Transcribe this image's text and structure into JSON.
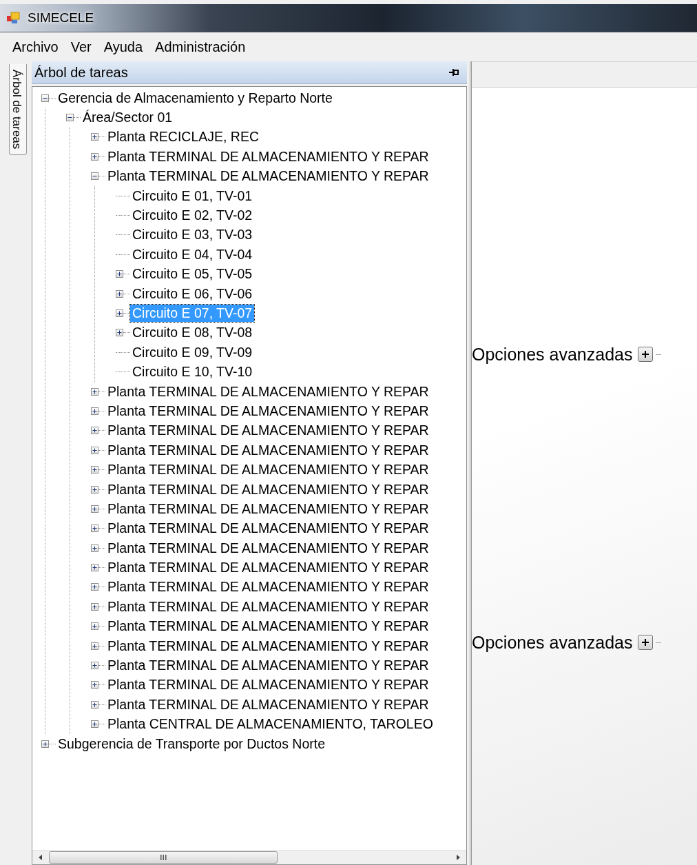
{
  "window": {
    "title": "SIMECELE"
  },
  "menu": [
    "Archivo",
    "Ver",
    "Ayuda",
    "Administración"
  ],
  "side_tab": {
    "label": "Árbol de tareas",
    "selected": true
  },
  "panel": {
    "title": "Árbol de tareas"
  },
  "tree": [
    {
      "label": "Gerencia de Almacenamiento y Reparto Norte",
      "expanded": true,
      "selected": false,
      "children": [
        {
          "label": "Área/Sector 01",
          "expanded": true,
          "selected": false,
          "children": [
            {
              "label": "Planta RECICLAJE, REC",
              "expanded": false,
              "selected": false
            },
            {
              "label": "Planta TERMINAL DE ALMACENAMIENTO Y REPAR",
              "expanded": false,
              "selected": false
            },
            {
              "label": "Planta TERMINAL DE ALMACENAMIENTO Y REPAR",
              "expanded": true,
              "selected": false,
              "children": [
                {
                  "label": "Circuito E 01, TV-01",
                  "selected": false
                },
                {
                  "label": "Circuito E 02, TV-02",
                  "selected": false
                },
                {
                  "label": "Circuito E 03, TV-03",
                  "selected": false
                },
                {
                  "label": "Circuito E 04, TV-04",
                  "selected": false
                },
                {
                  "label": "Circuito E 05, TV-05",
                  "expanded": false,
                  "selected": false
                },
                {
                  "label": "Circuito E 06, TV-06",
                  "expanded": false,
                  "selected": false
                },
                {
                  "label": "Circuito E 07, TV-07",
                  "expanded": false,
                  "selected": true
                },
                {
                  "label": "Circuito E 08, TV-08",
                  "expanded": false,
                  "selected": false
                },
                {
                  "label": "Circuito E 09, TV-09",
                  "selected": false
                },
                {
                  "label": "Circuito E 10, TV-10",
                  "selected": false
                }
              ]
            },
            {
              "label": "Planta TERMINAL DE ALMACENAMIENTO Y REPAR",
              "expanded": false,
              "selected": false
            },
            {
              "label": "Planta TERMINAL DE ALMACENAMIENTO Y REPAR",
              "expanded": false,
              "selected": false
            },
            {
              "label": "Planta TERMINAL DE ALMACENAMIENTO Y REPAR",
              "expanded": false,
              "selected": false
            },
            {
              "label": "Planta TERMINAL DE ALMACENAMIENTO Y REPAR",
              "expanded": false,
              "selected": false
            },
            {
              "label": "Planta TERMINAL DE ALMACENAMIENTO Y REPAR",
              "expanded": false,
              "selected": false
            },
            {
              "label": "Planta TERMINAL DE ALMACENAMIENTO Y REPAR",
              "expanded": false,
              "selected": false
            },
            {
              "label": "Planta TERMINAL DE ALMACENAMIENTO Y REPAR",
              "expanded": false,
              "selected": false
            },
            {
              "label": "Planta TERMINAL DE ALMACENAMIENTO Y REPAR",
              "expanded": false,
              "selected": false
            },
            {
              "label": "Planta TERMINAL DE ALMACENAMIENTO Y REPAR",
              "expanded": false,
              "selected": false
            },
            {
              "label": "Planta TERMINAL DE ALMACENAMIENTO Y REPAR",
              "expanded": false,
              "selected": false
            },
            {
              "label": "Planta TERMINAL DE ALMACENAMIENTO Y REPAR",
              "expanded": false,
              "selected": false
            },
            {
              "label": "Planta TERMINAL DE ALMACENAMIENTO Y REPAR",
              "expanded": false,
              "selected": false
            },
            {
              "label": "Planta TERMINAL DE ALMACENAMIENTO Y REPAR",
              "expanded": false,
              "selected": false
            },
            {
              "label": "Planta TERMINAL DE ALMACENAMIENTO Y REPAR",
              "expanded": false,
              "selected": false
            },
            {
              "label": "Planta TERMINAL DE ALMACENAMIENTO Y REPAR",
              "expanded": false,
              "selected": false
            },
            {
              "label": "Planta TERMINAL DE ALMACENAMIENTO Y REPAR",
              "expanded": false,
              "selected": false
            },
            {
              "label": "Planta TERMINAL DE ALMACENAMIENTO Y REPAR",
              "expanded": false,
              "selected": false
            },
            {
              "label": "Planta CENTRAL DE ALMACENAMIENTO, TAROLEO",
              "expanded": false,
              "selected": false
            }
          ]
        }
      ]
    },
    {
      "label": "Subgerencia de Transporte por Ductos Norte",
      "expanded": false,
      "selected": false
    }
  ],
  "advanced": [
    {
      "label": "Opciones avanzadas",
      "expanded": false
    },
    {
      "label": "Opciones avanzadas",
      "expanded": false
    }
  ]
}
